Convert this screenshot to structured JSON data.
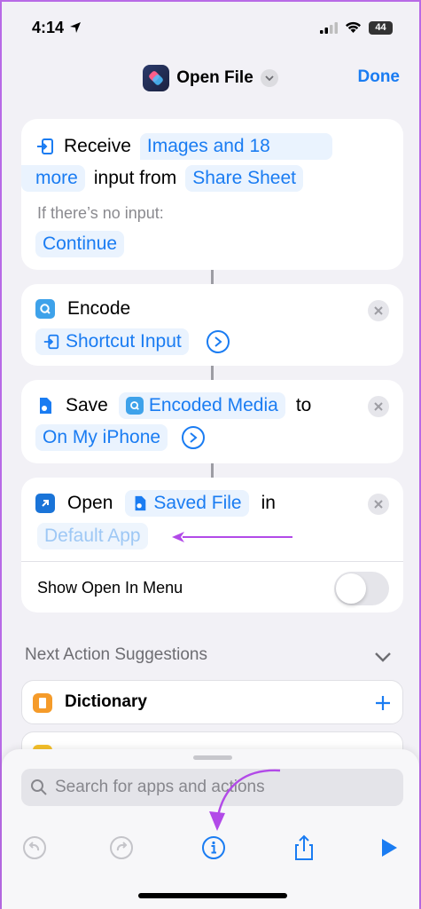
{
  "status_bar": {
    "time": "4:14",
    "battery": "44"
  },
  "nav": {
    "title": "Open File",
    "done_label": "Done"
  },
  "action_receive": {
    "verb": "Receive",
    "types_line1": "Images and 18",
    "types_line2": "more",
    "input_from": "input from",
    "source": "Share Sheet",
    "no_input_label": "If there’s no input:",
    "no_input_value": "Continue"
  },
  "action_encode": {
    "verb": "Encode",
    "input": "Shortcut Input"
  },
  "action_save": {
    "verb": "Save",
    "input": "Encoded Media",
    "to": "to",
    "destination": "On My iPhone"
  },
  "action_open": {
    "verb": "Open",
    "input": "Saved File",
    "in": "in",
    "app": "Default App",
    "option_label": "Show Open In Menu",
    "option_value": false
  },
  "suggestions": {
    "title": "Next Action Suggestions",
    "items": [
      {
        "label": "Dictionary"
      }
    ]
  },
  "bottom": {
    "search_placeholder": "Search for apps and actions"
  },
  "colors": {
    "accent": "#1a7cf2",
    "annotation": "#b24ae8"
  }
}
